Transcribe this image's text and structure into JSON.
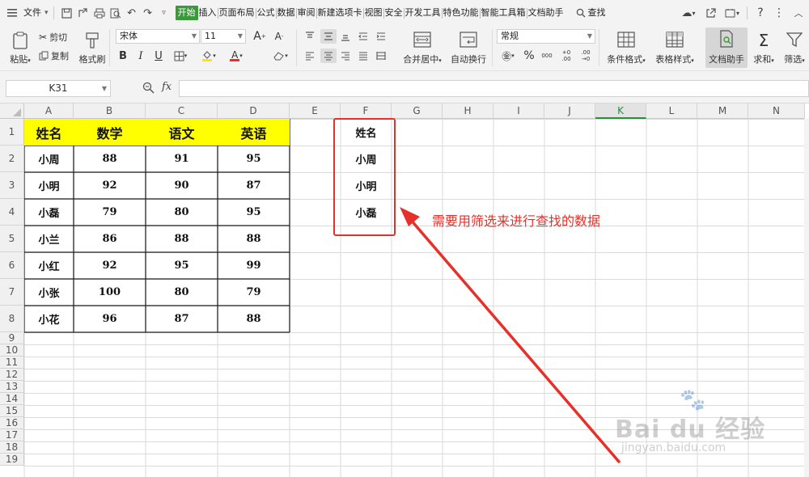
{
  "menu": {
    "file_label": "文件",
    "tabs": [
      "开始",
      "插入",
      "页面布局",
      "公式",
      "数据",
      "审阅",
      "新建选项卡",
      "视图",
      "安全",
      "开发工具",
      "特色功能",
      "智能工具箱",
      "文档助手"
    ],
    "active_tab": "开始",
    "search_label": "查找"
  },
  "ribbon": {
    "paste": "粘贴",
    "cut": "剪切",
    "copy": "复制",
    "format_painter": "格式刷",
    "font_name": "宋体",
    "font_size": "11",
    "merge_center": "合并居中",
    "wrap_text": "自动换行",
    "number_format": "常规",
    "conditional_format": "条件格式",
    "table_style": "表格样式",
    "doc_assistant": "文档助手",
    "sum": "求和",
    "filter": "筛选",
    "bold": "B",
    "italic": "I",
    "underline": "U",
    "percent": "%",
    "thousands": "000",
    "inc_decimal": "+0 .00",
    "dec_decimal": ".00 →0"
  },
  "formula_bar": {
    "cell_ref": "K31",
    "fx": "fx",
    "content": ""
  },
  "sheet": {
    "columns": [
      "A",
      "B",
      "C",
      "D",
      "E",
      "F",
      "G",
      "H",
      "I",
      "J",
      "K",
      "L",
      "M",
      "N"
    ],
    "rows": [
      "1",
      "2",
      "3",
      "4",
      "5",
      "6",
      "7",
      "8",
      "9",
      "10",
      "11",
      "12",
      "13",
      "14",
      "15",
      "16",
      "17",
      "18",
      "19"
    ],
    "selected_column": "K",
    "table_headers": [
      "姓名",
      "数学",
      "语文",
      "英语"
    ],
    "table_rows": [
      [
        "小周",
        "88",
        "91",
        "95"
      ],
      [
        "小明",
        "92",
        "90",
        "87"
      ],
      [
        "小磊",
        "79",
        "80",
        "95"
      ],
      [
        "小兰",
        "86",
        "88",
        "88"
      ],
      [
        "小红",
        "92",
        "95",
        "99"
      ],
      [
        "小张",
        "100",
        "80",
        "79"
      ],
      [
        "小花",
        "96",
        "87",
        "88"
      ]
    ],
    "criteria": [
      "姓名",
      "小周",
      "小明",
      "小磊"
    ]
  },
  "annotation": {
    "text": "需要用筛选来进行查找的数据",
    "color": "#e8302a"
  },
  "watermark": {
    "brand": "Bai du 经验",
    "url": "jingyan.baidu.com"
  },
  "colors": {
    "header_fill": "#ffff00",
    "active_tab": "#3a9a3a",
    "selected_col": "#2e8b3e"
  }
}
